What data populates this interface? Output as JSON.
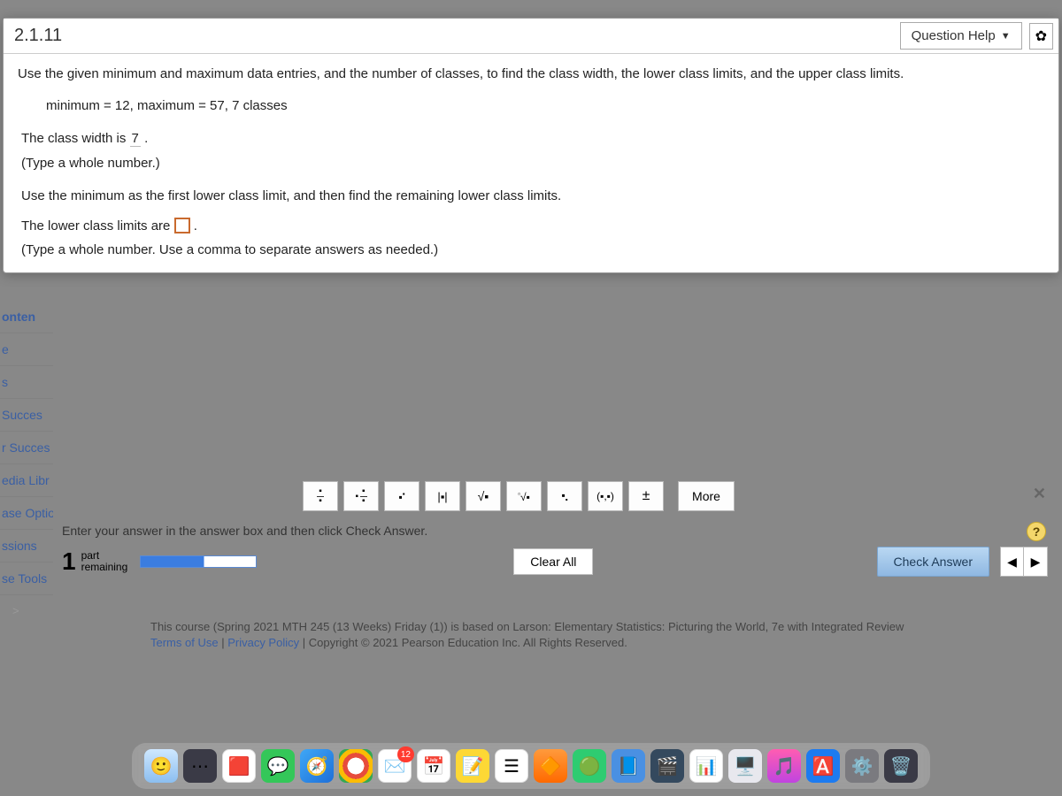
{
  "header": {
    "question_number": "2.1.11",
    "help_label": "Question Help"
  },
  "problem": {
    "prompt": "Use the given minimum and maximum data entries, and the number of classes, to find the class width, the lower class limits, and the upper class limits.",
    "given": "minimum = 12,  maximum = 57, 7 classes",
    "line_classwidth_pre": "The class width is ",
    "class_width_value": "7",
    "line_classwidth_post": " .",
    "hint1": "(Type a whole number.)",
    "line_lowerlimits_instr": "Use the minimum as the first lower class limit, and then find the remaining lower class limits.",
    "line_lowerlimits_pre": "The lower class limits are ",
    "hint2": "(Type a whole number. Use a comma to separate answers as needed.)"
  },
  "sidebar": {
    "items": [
      "onten",
      "e",
      "s",
      "Succes",
      "r Succes",
      "edia Libr",
      "ase Optio",
      "ssions",
      "se Tools"
    ],
    "chevron": ">"
  },
  "palette": {
    "buttons": [
      "frac",
      "mixfrac",
      "exp",
      "abs",
      "sqrt",
      "nroot",
      "sub",
      "coord",
      "pm"
    ],
    "more": "More"
  },
  "footer": {
    "instruction": "Enter your answer in the answer box and then click Check Answer.",
    "part_number": "1",
    "part_label_top": "part",
    "part_label_bottom": "remaining",
    "clear_all": "Clear All",
    "check_answer": "Check Answer"
  },
  "course": {
    "text_a": "This course (Spring 2021 MTH 245 (13 Weeks) Friday (1)) is based on Larson: Elementary Statistics: Picturing the World, 7e with Integrated Review",
    "terms": "Terms of Use",
    "privacy": "Privacy Policy",
    "copyright": "Copyright © 2021 Pearson Education Inc. All Rights Reserved."
  },
  "dock": {
    "mail_badge": "12"
  }
}
